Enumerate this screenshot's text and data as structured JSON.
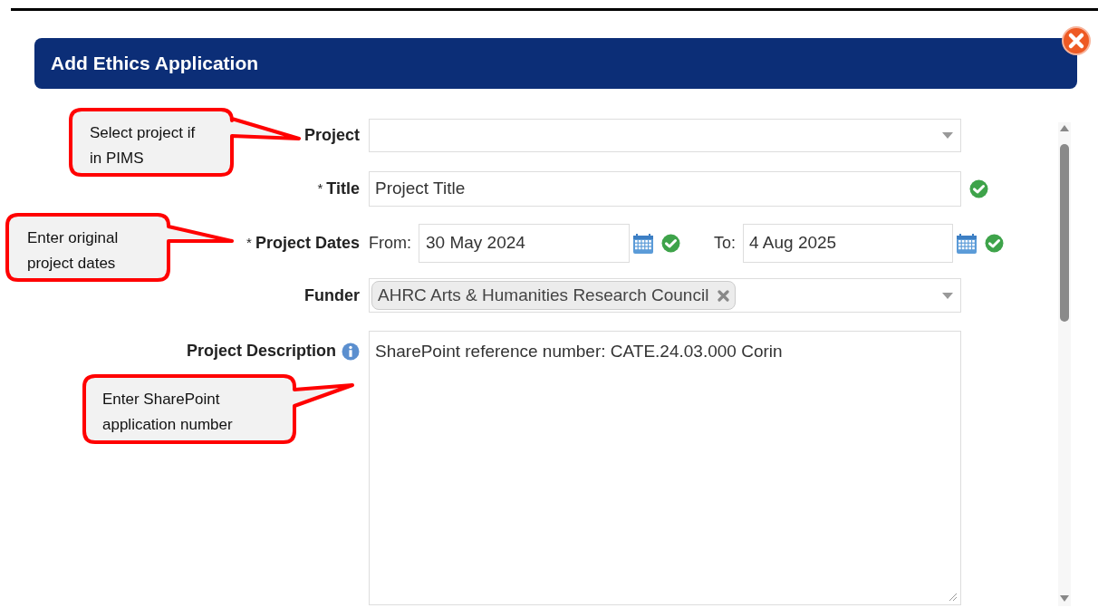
{
  "dialog": {
    "title": "Add Ethics Application"
  },
  "fields": [
    {
      "kind": "select",
      "label": "Project"
    },
    {
      "kind": "text",
      "marker": "*",
      "label": "Title",
      "value": "Project Title",
      "valid": true
    },
    {
      "kind": "daterange",
      "marker": "*",
      "label": "Project Dates",
      "from_label": "From:",
      "from": "30 May 2024",
      "from_valid": true,
      "to_label": "To:",
      "to": "4 Aug 2025",
      "to_valid": true
    },
    {
      "kind": "multiselect",
      "label": "Funder",
      "tags": [
        "AHRC Arts & Humanities Research Council"
      ]
    },
    {
      "kind": "textarea",
      "label": "Project Description",
      "info": true,
      "value": "SharePoint reference number: CATE.24.03.000 Corin"
    }
  ],
  "callouts": [
    {
      "lines": [
        "Select project if",
        "in PIMS"
      ]
    },
    {
      "lines": [
        "Enter original",
        "project dates"
      ]
    },
    {
      "lines": [
        "Enter SharePoint",
        "application number"
      ]
    }
  ]
}
